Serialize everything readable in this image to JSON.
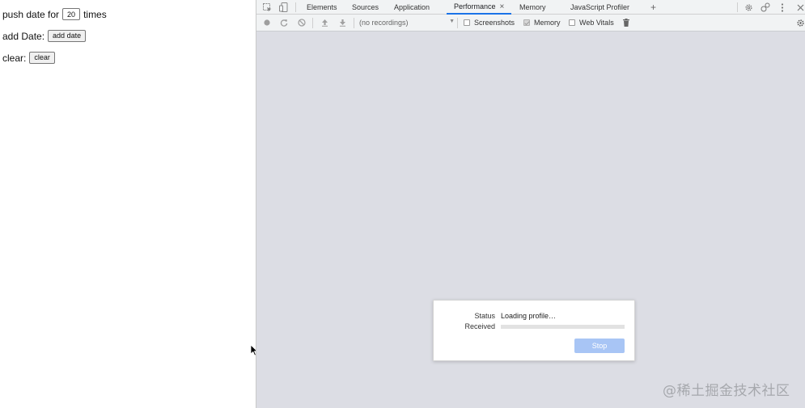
{
  "page": {
    "push_row": {
      "prefix": "push date for",
      "count_value": "20",
      "suffix": "times"
    },
    "add_row": {
      "label": "add Date:",
      "button_label": "add date"
    },
    "clear_row": {
      "label": "clear:",
      "button_label": "clear"
    }
  },
  "devtools": {
    "tabs": [
      {
        "label": "Elements",
        "active": false
      },
      {
        "label": "Sources",
        "active": false
      },
      {
        "label": "Application",
        "active": false
      },
      {
        "label": "Performance",
        "active": true,
        "close": "×"
      },
      {
        "label": "Memory",
        "active": false
      },
      {
        "label": "JavaScript Profiler",
        "active": false
      }
    ],
    "add_tab_glyph": "+",
    "toolbar": {
      "recordings_select": "(no recordings)",
      "screenshots_label": "Screenshots",
      "screenshots_checked": false,
      "memory_label": "Memory",
      "memory_checked": true,
      "web_vitals_label": "Web Vitals",
      "web_vitals_checked": false
    },
    "status_dialog": {
      "status_label": "Status",
      "status_value": "Loading profile…",
      "received_label": "Received",
      "received_progress": 0,
      "stop_label": "Stop"
    },
    "watermark": "@稀土掘金技术社区"
  },
  "colors": {
    "accent": "#1a73e8",
    "panel_bg": "#dcdde4",
    "toolbar_bg": "#f1f3f4",
    "stop_button": "#a8c5f5"
  }
}
